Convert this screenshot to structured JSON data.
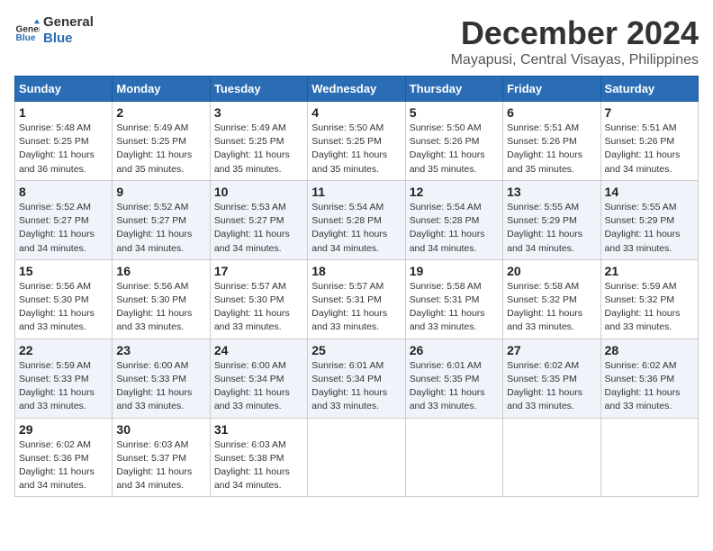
{
  "header": {
    "logo_line1": "General",
    "logo_line2": "Blue",
    "month": "December 2024",
    "location": "Mayapusi, Central Visayas, Philippines"
  },
  "weekdays": [
    "Sunday",
    "Monday",
    "Tuesday",
    "Wednesday",
    "Thursday",
    "Friday",
    "Saturday"
  ],
  "weeks": [
    [
      {
        "day": "1",
        "rise": "5:48 AM",
        "set": "5:25 PM",
        "daylight": "11 hours and 36 minutes."
      },
      {
        "day": "2",
        "rise": "5:49 AM",
        "set": "5:25 PM",
        "daylight": "11 hours and 35 minutes."
      },
      {
        "day": "3",
        "rise": "5:49 AM",
        "set": "5:25 PM",
        "daylight": "11 hours and 35 minutes."
      },
      {
        "day": "4",
        "rise": "5:50 AM",
        "set": "5:25 PM",
        "daylight": "11 hours and 35 minutes."
      },
      {
        "day": "5",
        "rise": "5:50 AM",
        "set": "5:26 PM",
        "daylight": "11 hours and 35 minutes."
      },
      {
        "day": "6",
        "rise": "5:51 AM",
        "set": "5:26 PM",
        "daylight": "11 hours and 35 minutes."
      },
      {
        "day": "7",
        "rise": "5:51 AM",
        "set": "5:26 PM",
        "daylight": "11 hours and 34 minutes."
      }
    ],
    [
      {
        "day": "8",
        "rise": "5:52 AM",
        "set": "5:27 PM",
        "daylight": "11 hours and 34 minutes."
      },
      {
        "day": "9",
        "rise": "5:52 AM",
        "set": "5:27 PM",
        "daylight": "11 hours and 34 minutes."
      },
      {
        "day": "10",
        "rise": "5:53 AM",
        "set": "5:27 PM",
        "daylight": "11 hours and 34 minutes."
      },
      {
        "day": "11",
        "rise": "5:54 AM",
        "set": "5:28 PM",
        "daylight": "11 hours and 34 minutes."
      },
      {
        "day": "12",
        "rise": "5:54 AM",
        "set": "5:28 PM",
        "daylight": "11 hours and 34 minutes."
      },
      {
        "day": "13",
        "rise": "5:55 AM",
        "set": "5:29 PM",
        "daylight": "11 hours and 34 minutes."
      },
      {
        "day": "14",
        "rise": "5:55 AM",
        "set": "5:29 PM",
        "daylight": "11 hours and 33 minutes."
      }
    ],
    [
      {
        "day": "15",
        "rise": "5:56 AM",
        "set": "5:30 PM",
        "daylight": "11 hours and 33 minutes."
      },
      {
        "day": "16",
        "rise": "5:56 AM",
        "set": "5:30 PM",
        "daylight": "11 hours and 33 minutes."
      },
      {
        "day": "17",
        "rise": "5:57 AM",
        "set": "5:30 PM",
        "daylight": "11 hours and 33 minutes."
      },
      {
        "day": "18",
        "rise": "5:57 AM",
        "set": "5:31 PM",
        "daylight": "11 hours and 33 minutes."
      },
      {
        "day": "19",
        "rise": "5:58 AM",
        "set": "5:31 PM",
        "daylight": "11 hours and 33 minutes."
      },
      {
        "day": "20",
        "rise": "5:58 AM",
        "set": "5:32 PM",
        "daylight": "11 hours and 33 minutes."
      },
      {
        "day": "21",
        "rise": "5:59 AM",
        "set": "5:32 PM",
        "daylight": "11 hours and 33 minutes."
      }
    ],
    [
      {
        "day": "22",
        "rise": "5:59 AM",
        "set": "5:33 PM",
        "daylight": "11 hours and 33 minutes."
      },
      {
        "day": "23",
        "rise": "6:00 AM",
        "set": "5:33 PM",
        "daylight": "11 hours and 33 minutes."
      },
      {
        "day": "24",
        "rise": "6:00 AM",
        "set": "5:34 PM",
        "daylight": "11 hours and 33 minutes."
      },
      {
        "day": "25",
        "rise": "6:01 AM",
        "set": "5:34 PM",
        "daylight": "11 hours and 33 minutes."
      },
      {
        "day": "26",
        "rise": "6:01 AM",
        "set": "5:35 PM",
        "daylight": "11 hours and 33 minutes."
      },
      {
        "day": "27",
        "rise": "6:02 AM",
        "set": "5:35 PM",
        "daylight": "11 hours and 33 minutes."
      },
      {
        "day": "28",
        "rise": "6:02 AM",
        "set": "5:36 PM",
        "daylight": "11 hours and 33 minutes."
      }
    ],
    [
      {
        "day": "29",
        "rise": "6:02 AM",
        "set": "5:36 PM",
        "daylight": "11 hours and 34 minutes."
      },
      {
        "day": "30",
        "rise": "6:03 AM",
        "set": "5:37 PM",
        "daylight": "11 hours and 34 minutes."
      },
      {
        "day": "31",
        "rise": "6:03 AM",
        "set": "5:38 PM",
        "daylight": "11 hours and 34 minutes."
      },
      null,
      null,
      null,
      null
    ]
  ],
  "labels": {
    "sunrise": "Sunrise:",
    "sunset": "Sunset:",
    "daylight": "Daylight:"
  }
}
